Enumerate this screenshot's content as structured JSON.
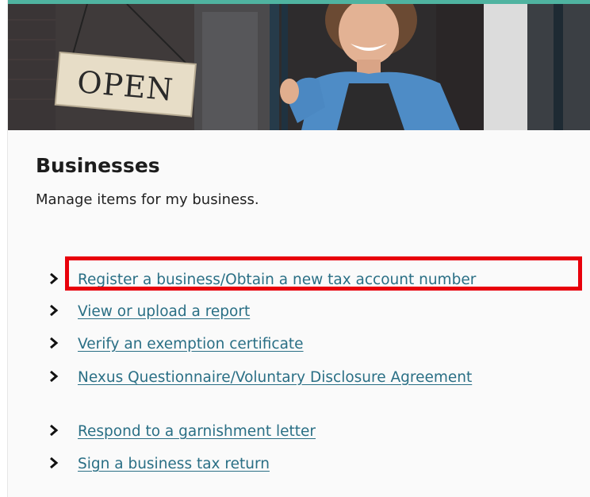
{
  "hero": {
    "sign_text": "OPEN"
  },
  "section": {
    "title": "Businesses",
    "subtitle": "Manage items for my business."
  },
  "links": [
    {
      "label": "Register a business/Obtain a new tax account number",
      "highlighted": true
    },
    {
      "label": "View or upload a report"
    },
    {
      "label": "Verify an exemption certificate"
    },
    {
      "label": "Nexus Questionnaire/Voluntary Disclosure Agreement"
    },
    {
      "label": "Respond to a garnishment letter"
    },
    {
      "label": "Sign a business tax return"
    }
  ],
  "colors": {
    "accent": "#4fb3a0",
    "link": "#2a6f85",
    "highlight": "#e8000b"
  },
  "icons": {
    "link_bullet": "chevron-right-icon"
  }
}
